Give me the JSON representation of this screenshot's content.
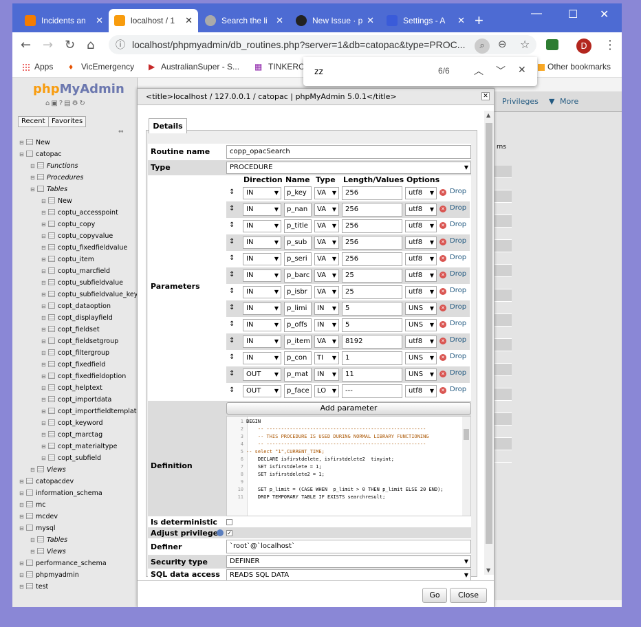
{
  "browser": {
    "tabs": [
      {
        "label": "Incidents an",
        "color": "#f57c00"
      },
      {
        "label": "localhost / 1",
        "color": "#f89c0e"
      },
      {
        "label": "Search the li",
        "color": "#888888"
      },
      {
        "label": "New Issue · p",
        "color": "#222222"
      },
      {
        "label": "Settings - A",
        "color": "#3a5bd9"
      }
    ],
    "new_tab": "+",
    "url": "localhost/phpmyadmin/db_routines.php?server=1&db=catopac&type=PROC...",
    "avatar": "D",
    "bookmarks": [
      "Apps",
      "VicEmergency",
      "AustralianSuper - S...",
      "TINKERC",
      "Other bookmarks"
    ],
    "find": {
      "query": "zz",
      "count": "6/6"
    }
  },
  "sidebar": {
    "logo_a": "php",
    "logo_b": "MyAdmin",
    "tabs": [
      "Recent",
      "Favorites"
    ],
    "tree": [
      {
        "label": "New",
        "indent": 0,
        "italic": false
      },
      {
        "label": "catopac",
        "indent": 0,
        "italic": false
      },
      {
        "label": "Functions",
        "indent": 1,
        "italic": true
      },
      {
        "label": "Procedures",
        "indent": 1,
        "italic": true
      },
      {
        "label": "Tables",
        "indent": 1,
        "italic": true
      },
      {
        "label": "New",
        "indent": 2,
        "italic": false
      },
      {
        "label": "coptu_accesspoint",
        "indent": 2,
        "italic": false
      },
      {
        "label": "coptu_copy",
        "indent": 2,
        "italic": false
      },
      {
        "label": "coptu_copyvalue",
        "indent": 2,
        "italic": false
      },
      {
        "label": "coptu_fixedfieldvalue",
        "indent": 2,
        "italic": false
      },
      {
        "label": "coptu_item",
        "indent": 2,
        "italic": false
      },
      {
        "label": "coptu_marcfield",
        "indent": 2,
        "italic": false
      },
      {
        "label": "coptu_subfieldvalue",
        "indent": 2,
        "italic": false
      },
      {
        "label": "coptu_subfieldvalue_key",
        "indent": 2,
        "italic": false
      },
      {
        "label": "copt_dataoption",
        "indent": 2,
        "italic": false
      },
      {
        "label": "copt_displayfield",
        "indent": 2,
        "italic": false
      },
      {
        "label": "copt_fieldset",
        "indent": 2,
        "italic": false
      },
      {
        "label": "copt_fieldsetgroup",
        "indent": 2,
        "italic": false
      },
      {
        "label": "copt_filtergroup",
        "indent": 2,
        "italic": false
      },
      {
        "label": "copt_fixedfield",
        "indent": 2,
        "italic": false
      },
      {
        "label": "copt_fixedfieldoption",
        "indent": 2,
        "italic": false
      },
      {
        "label": "copt_helptext",
        "indent": 2,
        "italic": false
      },
      {
        "label": "copt_importdata",
        "indent": 2,
        "italic": false
      },
      {
        "label": "copt_importfieldtemplat",
        "indent": 2,
        "italic": false
      },
      {
        "label": "copt_keyword",
        "indent": 2,
        "italic": false
      },
      {
        "label": "copt_marctag",
        "indent": 2,
        "italic": false
      },
      {
        "label": "copt_materialtype",
        "indent": 2,
        "italic": false
      },
      {
        "label": "copt_subfield",
        "indent": 2,
        "italic": false
      },
      {
        "label": "Views",
        "indent": 1,
        "italic": true
      },
      {
        "label": "catopacdev",
        "indent": 0,
        "italic": false
      },
      {
        "label": "information_schema",
        "indent": 0,
        "italic": false
      },
      {
        "label": "mc",
        "indent": 0,
        "italic": false
      },
      {
        "label": "mcdev",
        "indent": 0,
        "italic": false
      },
      {
        "label": "mysql",
        "indent": 0,
        "italic": false
      },
      {
        "label": "Tables",
        "indent": 1,
        "italic": true
      },
      {
        "label": "Views",
        "indent": 1,
        "italic": true
      },
      {
        "label": "performance_schema",
        "indent": 0,
        "italic": false
      },
      {
        "label": "phpmyadmin",
        "indent": 0,
        "italic": false
      },
      {
        "label": "test",
        "indent": 0,
        "italic": false
      }
    ]
  },
  "right": {
    "tabs": [
      "Privileges",
      "More"
    ],
    "col_header": "rns"
  },
  "dialog": {
    "title": "<title>localhost / 127.0.0.1 / catopac | phpMyAdmin 5.0.1</title>",
    "legend": "Details",
    "labels": {
      "routine_name": "Routine name",
      "type": "Type",
      "parameters": "Parameters",
      "definition": "Definition",
      "deterministic": "Is deterministic",
      "adjust": "Adjust privileges",
      "definer": "Definer",
      "security": "Security type",
      "sql_access": "SQL data access"
    },
    "routine_name": "copp_opacSearch",
    "type": "PROCEDURE",
    "param_headers": [
      "Direction",
      "Name",
      "Type",
      "Length/Values",
      "Options"
    ],
    "params": [
      {
        "dir": "IN",
        "name": "p_key",
        "type": "VA",
        "len": "256",
        "opt": "utf8"
      },
      {
        "dir": "IN",
        "name": "p_nan",
        "type": "VA",
        "len": "256",
        "opt": "utf8"
      },
      {
        "dir": "IN",
        "name": "p_title",
        "type": "VA",
        "len": "256",
        "opt": "utf8"
      },
      {
        "dir": "IN",
        "name": "p_sub",
        "type": "VA",
        "len": "256",
        "opt": "utf8"
      },
      {
        "dir": "IN",
        "name": "p_seri",
        "type": "VA",
        "len": "256",
        "opt": "utf8"
      },
      {
        "dir": "IN",
        "name": "p_barc",
        "type": "VA",
        "len": "25",
        "opt": "utf8"
      },
      {
        "dir": "IN",
        "name": "p_isbr",
        "type": "VA",
        "len": "25",
        "opt": "utf8"
      },
      {
        "dir": "IN",
        "name": "p_limi",
        "type": "IN",
        "len": "5",
        "opt": "UNS"
      },
      {
        "dir": "IN",
        "name": "p_offs",
        "type": "IN",
        "len": "5",
        "opt": "UNS"
      },
      {
        "dir": "IN",
        "name": "p_item",
        "type": "VA",
        "len": "8192",
        "opt": "utf8"
      },
      {
        "dir": "IN",
        "name": "p_con",
        "type": "TI",
        "len": "1",
        "opt": "UNS"
      },
      {
        "dir": "OUT",
        "name": "p_mat",
        "type": "IN",
        "len": "11",
        "opt": "UNS"
      },
      {
        "dir": "OUT",
        "name": "p_face",
        "type": "LO",
        "len": "---",
        "opt": "utf8"
      }
    ],
    "drop": "Drop",
    "add_param": "Add parameter",
    "code": [
      "BEGIN",
      "    -- -------------------------------------------------------",
      "    -- THIS PROCEDURE IS USED DURING NORMAL LIBRARY FUNCTIONING",
      "    -- -------------------------------------------------------",
      "-- select \"1\",CURRENT_TIME;",
      "    DECLARE isfirstdelete, isfirstdelete2  tinyint;",
      "    SET isfirstdelete = 1;",
      "    SET isfirstdelete2 = 1;",
      "",
      "    SET p_limit = (CASE WHEN  p_limit > 0 THEN p_limit ELSE 20 END);",
      "    DROP TEMPORARY TABLE IF EXISTS searchresult;"
    ],
    "definer": "`root`@`localhost`",
    "security": "DEFINER",
    "sql_access": "READS SQL DATA",
    "go": "Go",
    "close": "Close"
  }
}
